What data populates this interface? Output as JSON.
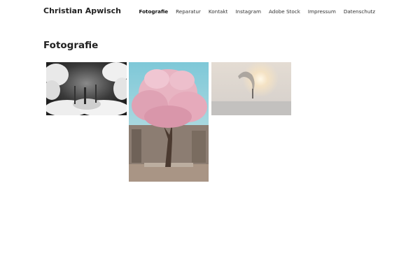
{
  "site": {
    "title": "Christian Apwisch"
  },
  "nav": {
    "items": [
      {
        "label": "Fotografie",
        "active": true
      },
      {
        "label": "Reparatur"
      },
      {
        "label": "Kontakt"
      },
      {
        "label": "Instagram"
      },
      {
        "label": "Adobe Stock"
      },
      {
        "label": "Impressum"
      },
      {
        "label": "Datenschutz"
      }
    ]
  },
  "page": {
    "title": "Fotografie"
  },
  "gallery": {
    "photos": [
      {
        "subject": "black and white infrared forest"
      },
      {
        "subject": "pink magnolia tree in courtyard"
      },
      {
        "subject": "hazy sun over industrial smoke"
      }
    ]
  }
}
